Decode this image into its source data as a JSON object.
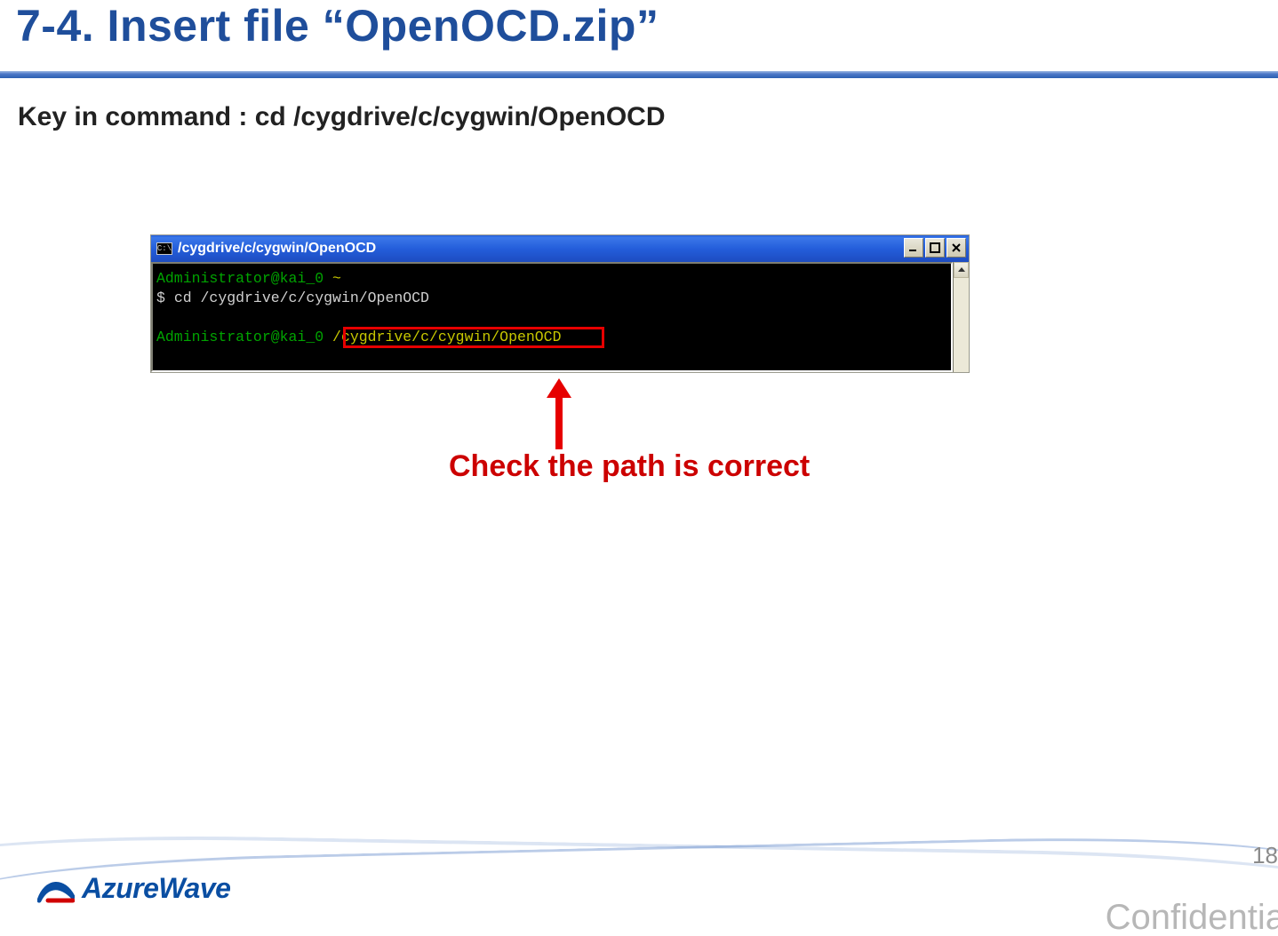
{
  "title": "7-4. Insert file “OpenOCD.zip”",
  "subtitle": "Key in command : cd /cygdrive/c/cygwin/OpenOCD",
  "terminal": {
    "titlebar_icon_text": "C:\\",
    "titlebar_text": "/cygdrive/c/cygwin/OpenOCD",
    "line1_user": "Administrator@kai_0 ",
    "line1_tilde": "~",
    "line2_prompt": "$ ",
    "line2_cmd": "cd /cygdrive/c/cygwin/OpenOCD",
    "line3_user": "Administrator@kai_0 ",
    "line3_path": "/cygdrive/c/cygwin/OpenOCD"
  },
  "annotation": "Check the path is correct",
  "footer": {
    "brand": "AzureWave",
    "page_number": "18",
    "confidential": "Confidentia"
  }
}
